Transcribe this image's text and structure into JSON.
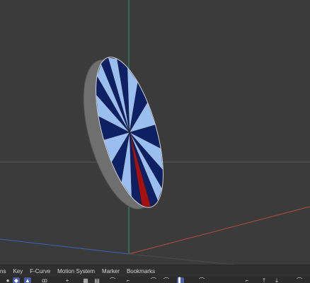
{
  "viewport": {
    "background": "#3b3b3b",
    "colors": {
      "axis_y": "#2e9a6e",
      "axis_x": "#b84a45",
      "axis_z": "#3a66b8",
      "horizon": "#5a5a5a",
      "segment_dark": "#0e2064",
      "segment_light": "#9bbef0",
      "segment_red": "#a51010",
      "rim": "#7a7a7a"
    }
  },
  "menu": {
    "items": [
      "ns",
      "Key",
      "F-Curve",
      "Motion System",
      "Marker",
      "Bookmarks"
    ]
  },
  "toolbar": {
    "icons": [
      "record-icon",
      "keyframe-icon",
      "lock-icon",
      "add-icon",
      "move-icon",
      "grid-icon",
      "curve-icon",
      "link-icon",
      "key-icon",
      "ease-icon",
      "keyframe-select-icon",
      "tangent-icon",
      "slope-icon",
      "step-icon",
      "auto-icon",
      "bookmark-icon"
    ]
  }
}
